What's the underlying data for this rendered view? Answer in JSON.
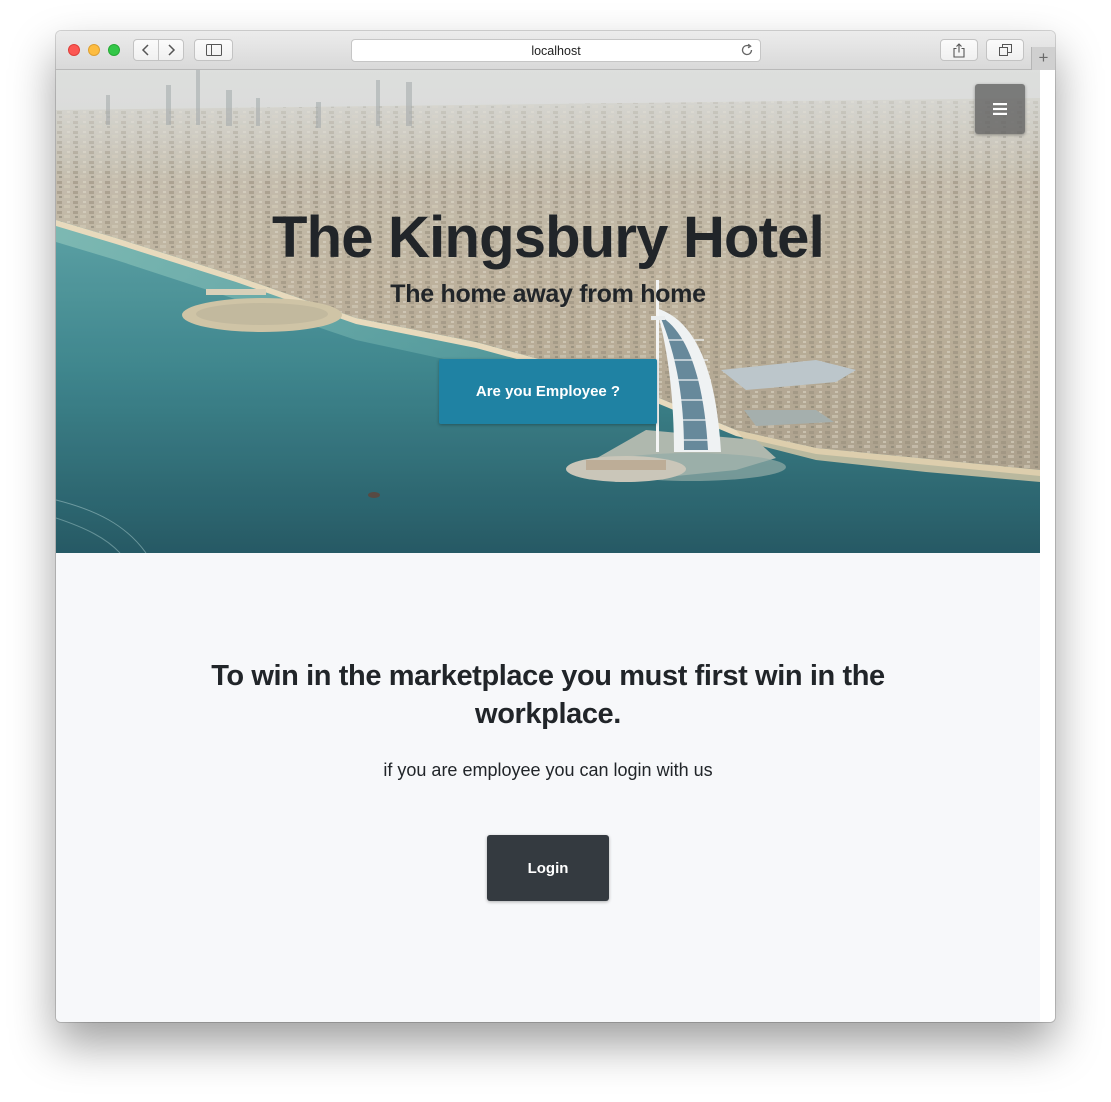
{
  "browser": {
    "address": "localhost",
    "icons": {
      "back": "chevron-left-icon",
      "forward": "chevron-right-icon",
      "sidebar": "sidebar-icon",
      "reload": "reload-icon",
      "share": "share-icon",
      "tabs": "tabs-overview-icon",
      "new_tab": "plus-icon"
    }
  },
  "hero": {
    "title": "The Kingsbury Hotel",
    "subtitle": "The home away from home",
    "cta_label": "Are you Employee ?",
    "menu_icon": "hamburger-menu-icon"
  },
  "section": {
    "heading": "To win in the marketplace you must first win in the workplace.",
    "subtext": "if you are employee you can login with us",
    "login_label": "Login"
  },
  "colors": {
    "cta_button": "#1f82a3",
    "login_button": "#343a40",
    "section_background": "#f7f8fa",
    "text": "#212529"
  }
}
